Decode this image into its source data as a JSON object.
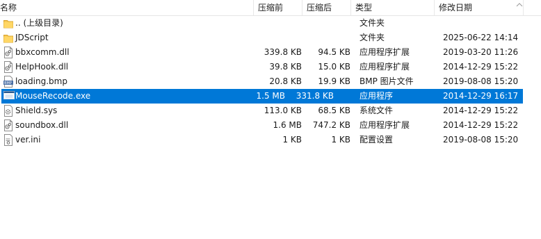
{
  "columns": {
    "name": "名称",
    "compressed_size": "压缩前",
    "original_size": "压缩后",
    "type": "类型",
    "modified": "修改日期"
  },
  "files": [
    {
      "icon": "folder-icon",
      "name": ".. (上级目录)",
      "csize": "",
      "osize": "",
      "type": "文件夹",
      "date": ""
    },
    {
      "icon": "folder-icon",
      "name": "JDScript",
      "csize": "",
      "osize": "",
      "type": "文件夹",
      "date": "2025-06-22 14:14"
    },
    {
      "icon": "dll-file-icon",
      "name": "bbxcomm.dll",
      "csize": "339.8 KB",
      "osize": "94.5 KB",
      "type": "应用程序扩展",
      "date": "2019-03-20 11:26"
    },
    {
      "icon": "dll-file-icon",
      "name": "HelpHook.dll",
      "csize": "39.8 KB",
      "osize": "15.0 KB",
      "type": "应用程序扩展",
      "date": "2014-12-29 15:22"
    },
    {
      "icon": "bmp-file-icon",
      "name": "loading.bmp",
      "csize": "20.8 KB",
      "osize": "19.9 KB",
      "type": "BMP 图片文件",
      "date": "2019-08-08 15:20"
    },
    {
      "icon": "exe-file-icon",
      "name": "MouseRecode.exe",
      "csize": "1.5 MB",
      "osize": "331.8 KB",
      "type": "应用程序",
      "date": "2014-12-29 16:17",
      "selected": true
    },
    {
      "icon": "sys-file-icon",
      "name": "Shield.sys",
      "csize": "113.0 KB",
      "osize": "68.5 KB",
      "type": "系统文件",
      "date": "2014-12-29 15:22"
    },
    {
      "icon": "dll-file-icon",
      "name": "soundbox.dll",
      "csize": "1.6 MB",
      "osize": "747.2 KB",
      "type": "应用程序扩展",
      "date": "2014-12-29 15:22"
    },
    {
      "icon": "ini-file-icon",
      "name": "ver.ini",
      "csize": "1 KB",
      "osize": "1 KB",
      "type": "配置设置",
      "date": "2019-08-08 15:20"
    }
  ],
  "colors": {
    "selection": "#0078d7",
    "folder": "#f5c451",
    "header_separator": "#e8e8e8"
  }
}
